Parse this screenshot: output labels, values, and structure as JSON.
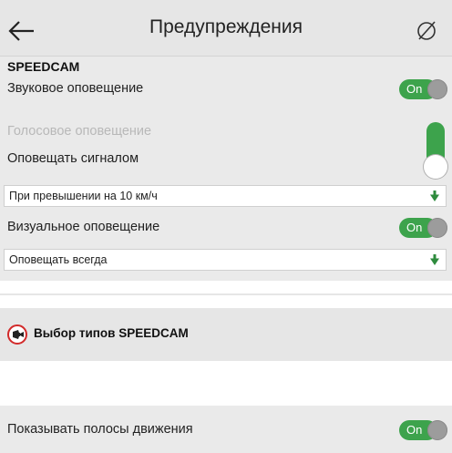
{
  "header": {
    "title": "Предупреждения",
    "back_icon": "arrow-left-icon",
    "action_icon": "crossed-circle-icon"
  },
  "speedcam": {
    "section_title": "SPEEDCAM",
    "sound_alert": {
      "label": "Звуковое оповещение",
      "toggle_text": "On"
    },
    "voice_alert": {
      "label": "Голосовое оповещение",
      "enabled": false
    },
    "signal_alert": {
      "label": "Оповещать сигналом"
    },
    "speed_threshold": {
      "value": "При превышении на 10 км/ч"
    },
    "visual_alert": {
      "label": "Визуальное оповещение",
      "toggle_text": "On"
    },
    "visual_mode": {
      "value": "Оповещать всегда"
    }
  },
  "speedcam_types": {
    "label": "Выбор типов SPEEDCAM",
    "icon": "speedcam-icon"
  },
  "lanes": {
    "label": "Показывать полосы движения",
    "toggle_text": "On"
  },
  "colors": {
    "toggle_on": "#3da34c",
    "dropdown_arrow": "#2e8b3d",
    "speedcam_icon_ring": "#d22a2a",
    "header_bg": "#e6e6e6"
  }
}
